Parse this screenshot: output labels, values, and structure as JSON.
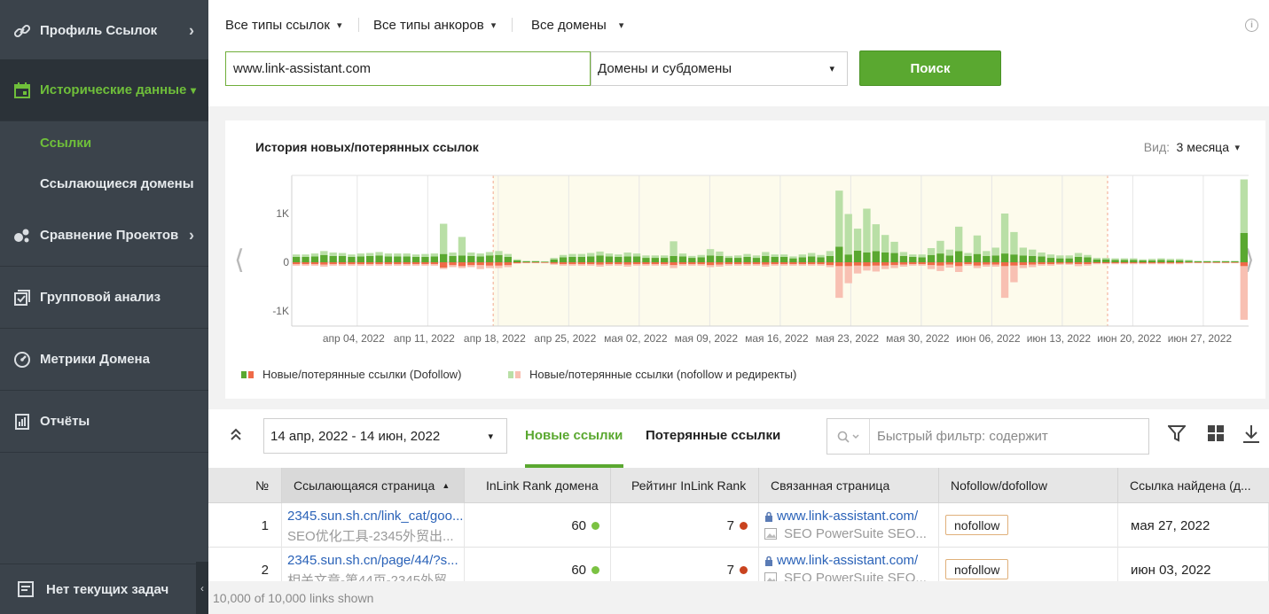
{
  "sidebar": {
    "items": [
      {
        "label": "Профиль Ссылок",
        "icon": "link-icon"
      },
      {
        "label": "Исторические данные",
        "icon": "calendar-icon"
      },
      {
        "label": "Сравнение Проектов",
        "icon": "compare-icon"
      },
      {
        "label": "Групповой анализ",
        "icon": "checklist-icon"
      },
      {
        "label": "Метрики Домена",
        "icon": "gauge-icon"
      },
      {
        "label": "Отчёты",
        "icon": "report-icon"
      }
    ],
    "sub_items": [
      {
        "label": "Ссылки"
      },
      {
        "label": "Ссылающиеся домены"
      }
    ],
    "tasks_label": "Нет текущих задач"
  },
  "topbar": {
    "link_types": "Все типы ссылок",
    "anchor_types": "Все типы анкоров",
    "domains": "Все домены",
    "url_value": "www.link-assistant.com",
    "scope": "Домены и субдомены",
    "search_label": "Поиск"
  },
  "chart_card": {
    "title": "История новых/потерянных ссылок",
    "view_label": "Вид:",
    "view_value": "3 месяца",
    "legend": [
      "Новые/потерянные ссылки (Dofollow)",
      "Новые/потерянные ссылки (nofollow и редиректы)"
    ]
  },
  "chart_data": {
    "type": "bar",
    "title": "История новых/потерянных ссылок",
    "ylabels": [
      "1K",
      "0",
      "-1K"
    ],
    "ylim": [
      -1200,
      1800
    ],
    "xticks": [
      "апр 04, 2022",
      "апр 11, 2022",
      "апр 18, 2022",
      "апр 25, 2022",
      "мая 02, 2022",
      "мая 09, 2022",
      "мая 16, 2022",
      "мая 23, 2022",
      "мая 30, 2022",
      "июн 06, 2022",
      "июн 13, 2022",
      "июн 20, 2022",
      "июн 27, 2022"
    ],
    "selected_range": [
      "апр 14, 2022",
      "июн 14, 2022"
    ],
    "series": [
      {
        "name": "Новые ссылки (Dofollow)",
        "color": "#5aa830",
        "values": [
          110,
          110,
          120,
          150,
          130,
          130,
          110,
          120,
          130,
          140,
          120,
          120,
          120,
          110,
          110,
          120,
          170,
          130,
          140,
          130,
          120,
          140,
          150,
          110,
          40,
          20,
          20,
          10,
          60,
          100,
          110,
          110,
          120,
          140,
          120,
          110,
          120,
          120,
          90,
          90,
          90,
          130,
          120,
          90,
          100,
          140,
          130,
          90,
          90,
          110,
          90,
          130,
          110,
          110,
          80,
          100,
          120,
          100,
          130,
          320,
          160,
          240,
          200,
          230,
          200,
          190,
          130,
          110,
          100,
          150,
          180,
          140,
          230,
          130,
          170,
          130,
          140,
          180,
          160,
          140,
          130,
          120,
          90,
          80,
          80,
          110,
          100,
          60,
          60,
          50,
          50,
          50,
          40,
          40,
          50,
          40,
          40,
          30,
          20,
          20,
          20,
          20,
          20,
          600
        ]
      },
      {
        "name": "Новые ссылки (nofollow и редиректы)",
        "color": "#b9dfa6",
        "values": [
          50,
          50,
          60,
          80,
          70,
          60,
          50,
          60,
          60,
          70,
          60,
          60,
          60,
          50,
          60,
          60,
          620,
          70,
          380,
          70,
          60,
          70,
          80,
          60,
          20,
          10,
          10,
          10,
          30,
          50,
          60,
          60,
          70,
          80,
          60,
          50,
          80,
          60,
          50,
          50,
          50,
          300,
          60,
          40,
          50,
          130,
          90,
          40,
          50,
          60,
          50,
          80,
          50,
          50,
          40,
          60,
          70,
          50,
          100,
          1150,
          830,
          450,
          900,
          550,
          360,
          230,
          80,
          50,
          60,
          140,
          260,
          120,
          500,
          60,
          380,
          100,
          160,
          820,
          460,
          160,
          130,
          80,
          70,
          60,
          60,
          80,
          50,
          30,
          30,
          30,
          30,
          30,
          20,
          30,
          30,
          30,
          30,
          20,
          10,
          10,
          10,
          10,
          10,
          1100
        ]
      },
      {
        "name": "Потерянные ссылки (Dofollow)",
        "color": "#ef6a48",
        "values": [
          -40,
          -40,
          -40,
          -50,
          -40,
          -40,
          -40,
          -40,
          -40,
          -40,
          -40,
          -40,
          -40,
          -40,
          -40,
          -40,
          -110,
          -60,
          -80,
          -60,
          -60,
          -70,
          -70,
          -60,
          -20,
          -10,
          -10,
          -10,
          -30,
          -40,
          -40,
          -40,
          -40,
          -50,
          -40,
          -40,
          -50,
          -40,
          -40,
          -40,
          -40,
          -60,
          -40,
          -40,
          -40,
          -60,
          -50,
          -40,
          -40,
          -40,
          -40,
          -50,
          -40,
          -40,
          -40,
          -40,
          -40,
          -40,
          -60,
          -80,
          -80,
          -70,
          -80,
          -70,
          -70,
          -60,
          -50,
          -40,
          -40,
          -60,
          -70,
          -50,
          -80,
          -40,
          -70,
          -50,
          -50,
          -80,
          -70,
          -60,
          -50,
          -40,
          -40,
          -30,
          -30,
          -40,
          -40,
          -20,
          -20,
          -20,
          -20,
          -20,
          -20,
          -20,
          -20,
          -20,
          -20,
          -10,
          -10,
          -10,
          -10,
          -10,
          -10,
          -80
        ]
      },
      {
        "name": "Потерянные ссылки (nofollow и редиректы)",
        "color": "#f8c0b2",
        "values": [
          -30,
          -30,
          -30,
          -40,
          -30,
          -30,
          -30,
          -30,
          -30,
          -30,
          -30,
          -30,
          -30,
          -30,
          -30,
          -30,
          -30,
          -40,
          -40,
          -40,
          -80,
          -50,
          -50,
          -40,
          -10,
          -10,
          -10,
          -10,
          -20,
          -30,
          -30,
          -30,
          -30,
          -40,
          -30,
          -30,
          -40,
          -30,
          -30,
          -30,
          -30,
          -60,
          -30,
          -30,
          -30,
          -40,
          -40,
          -30,
          -30,
          -30,
          -30,
          -40,
          -30,
          -30,
          -30,
          -30,
          -30,
          -30,
          -40,
          -650,
          -350,
          -160,
          -90,
          -120,
          -70,
          -60,
          -40,
          -30,
          -30,
          -80,
          -110,
          -60,
          -120,
          -30,
          -50,
          -40,
          -40,
          -650,
          -340,
          -60,
          -50,
          -30,
          -30,
          -20,
          -20,
          -40,
          -30,
          -20,
          -20,
          -20,
          -20,
          -20,
          -20,
          -20,
          -20,
          -20,
          -20,
          -10,
          -10,
          -10,
          -10,
          -10,
          -10,
          -1100
        ]
      }
    ]
  },
  "table_toolbar": {
    "date_range": "14 апр, 2022 - 14 июн, 2022",
    "tab_new": "Новые ссылки",
    "tab_lost": "Потерянные ссылки",
    "filter_placeholder": "Быстрый фильтр: содержит"
  },
  "table": {
    "columns": [
      "№",
      "Ссылающаяся страница",
      "InLink Rank домена",
      "Рейтинг InLink Rank",
      "Связанная страница",
      "Nofollow/dofollow",
      "Ссылка найдена (д..."
    ],
    "rows": [
      {
        "num": "1",
        "page_url": "2345.sun.sh.cn/link_cat/goo...",
        "page_title": "SEO优化工具-2345外贸出...",
        "domain_rank": "60",
        "rank": "7",
        "target_url": "www.link-assistant.com/",
        "target_title": "SEO PowerSuite SEO...",
        "follow": "nofollow",
        "found": "мая 27, 2022",
        "domain_dot": "#7bc242",
        "rank_dot": "#c9431f"
      },
      {
        "num": "2",
        "page_url": "2345.sun.sh.cn/page/44/?s...",
        "page_title": "相关文章-第44页-2345外贸...",
        "domain_rank": "60",
        "rank": "7",
        "target_url": "www.link-assistant.com/",
        "target_title": "SEO PowerSuite SEO...",
        "follow": "nofollow",
        "found": "июн 03, 2022",
        "domain_dot": "#7bc242",
        "rank_dot": "#c9431f"
      }
    ]
  },
  "footer": {
    "shown": "10,000 of 10,000 links shown"
  }
}
